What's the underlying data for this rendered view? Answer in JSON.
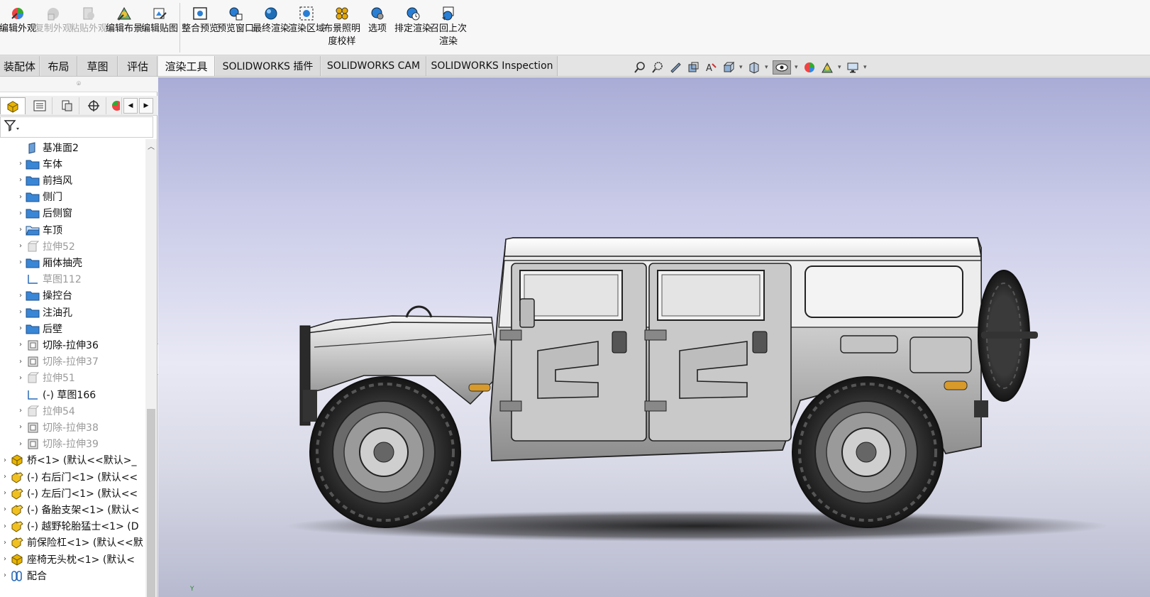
{
  "ribbon": {
    "buttons": [
      {
        "label": "编辑外观",
        "icon": "edit-appearance-icon",
        "enabled": true
      },
      {
        "label": "复制外观",
        "icon": "copy-appearance-icon",
        "enabled": false
      },
      {
        "label": "粘贴外观",
        "icon": "paste-appearance-icon",
        "enabled": false
      },
      {
        "label": "编辑布景",
        "icon": "edit-scene-icon",
        "enabled": true
      },
      {
        "label": "编辑贴图",
        "icon": "edit-decal-icon",
        "enabled": true
      },
      {
        "label": "整合预览",
        "icon": "integrated-preview-icon",
        "enabled": true
      },
      {
        "label": "预览窗口",
        "icon": "preview-window-icon",
        "enabled": true
      },
      {
        "label": "最终渲染",
        "icon": "final-render-icon",
        "enabled": true
      },
      {
        "label": "渲染区域",
        "icon": "render-region-icon",
        "enabled": true
      },
      {
        "label": "布景照明度校样",
        "icon": "scene-illumination-proof-icon",
        "enabled": true
      },
      {
        "label": "选项",
        "icon": "options-icon",
        "enabled": true
      },
      {
        "label": "排定渲染",
        "icon": "schedule-render-icon",
        "enabled": true
      },
      {
        "label": "召回上次渲染",
        "icon": "recall-last-render-icon",
        "enabled": true
      }
    ]
  },
  "tabs": [
    {
      "label": "装配体",
      "active": false
    },
    {
      "label": "布局",
      "active": false
    },
    {
      "label": "草图",
      "active": false
    },
    {
      "label": "评估",
      "active": false
    },
    {
      "label": "渲染工具",
      "active": true
    },
    {
      "label": "SOLIDWORKS 插件",
      "active": false
    },
    {
      "label": "SOLIDWORKS CAM",
      "active": false
    },
    {
      "label": "SOLIDWORKS Inspection",
      "active": false
    }
  ],
  "tree": {
    "items": [
      {
        "label": "基准面2",
        "icon": "plane-icon",
        "level": 2,
        "expandable": false,
        "dim": false
      },
      {
        "label": "车体",
        "icon": "folder-icon",
        "level": 2,
        "expandable": true,
        "dim": false
      },
      {
        "label": "前挡风",
        "icon": "folder-icon",
        "level": 2,
        "expandable": true,
        "dim": false
      },
      {
        "label": "侧门",
        "icon": "folder-icon",
        "level": 2,
        "expandable": true,
        "dim": false
      },
      {
        "label": "后侧窗",
        "icon": "folder-icon",
        "level": 2,
        "expandable": true,
        "dim": false
      },
      {
        "label": "车顶",
        "icon": "folder-open-icon",
        "level": 2,
        "expandable": true,
        "dim": false
      },
      {
        "label": "拉伸52",
        "icon": "extrude-icon",
        "level": 2,
        "expandable": true,
        "dim": true
      },
      {
        "label": "厢体抽壳",
        "icon": "folder-icon",
        "level": 2,
        "expandable": true,
        "dim": false
      },
      {
        "label": "草图112",
        "icon": "sketch-icon",
        "level": 2,
        "expandable": false,
        "dim": true
      },
      {
        "label": "操控台",
        "icon": "folder-icon",
        "level": 2,
        "expandable": true,
        "dim": false
      },
      {
        "label": "注油孔",
        "icon": "folder-icon",
        "level": 2,
        "expandable": true,
        "dim": false
      },
      {
        "label": "后壁",
        "icon": "folder-icon",
        "level": 2,
        "expandable": true,
        "dim": false
      },
      {
        "label": "切除-拉伸36",
        "icon": "cut-extrude-icon",
        "level": 2,
        "expandable": true,
        "dim": false
      },
      {
        "label": "切除-拉伸37",
        "icon": "cut-extrude-icon",
        "level": 2,
        "expandable": true,
        "dim": true
      },
      {
        "label": "拉伸51",
        "icon": "extrude-icon",
        "level": 2,
        "expandable": true,
        "dim": true
      },
      {
        "label": "(-) 草图166",
        "icon": "sketch-icon",
        "level": 2,
        "expandable": false,
        "dim": false
      },
      {
        "label": "拉伸54",
        "icon": "extrude-icon",
        "level": 2,
        "expandable": true,
        "dim": true
      },
      {
        "label": "切除-拉伸38",
        "icon": "cut-extrude-icon",
        "level": 2,
        "expandable": true,
        "dim": true
      },
      {
        "label": "切除-拉伸39",
        "icon": "cut-extrude-icon",
        "level": 2,
        "expandable": true,
        "dim": true
      },
      {
        "label": "桥<1> (默认<<默认>_",
        "icon": "subassembly-icon",
        "level": 1,
        "expandable": true,
        "dim": false
      },
      {
        "label": "(-) 右后门<1> (默认<<",
        "icon": "part-icon",
        "level": 1,
        "expandable": true,
        "dim": false
      },
      {
        "label": "(-) 左后门<1> (默认<<",
        "icon": "part-icon",
        "level": 1,
        "expandable": true,
        "dim": false
      },
      {
        "label": "(-) 备胎支架<1> (默认<",
        "icon": "part-icon",
        "level": 1,
        "expandable": true,
        "dim": false
      },
      {
        "label": "(-) 越野轮胎猛士<1> (D",
        "icon": "part-icon",
        "level": 1,
        "expandable": true,
        "dim": false
      },
      {
        "label": "前保险杠<1> (默认<<默",
        "icon": "part-icon",
        "level": 1,
        "expandable": true,
        "dim": false
      },
      {
        "label": "座椅无头枕<1> (默认<",
        "icon": "subassembly-icon",
        "level": 1,
        "expandable": true,
        "dim": false
      },
      {
        "label": "配合",
        "icon": "mates-icon",
        "level": 1,
        "expandable": true,
        "dim": false
      }
    ]
  },
  "colors": {
    "accent_blue": "#2a7fd4",
    "folder_blue": "#3a86d6",
    "part_yellow": "#e8b400"
  }
}
